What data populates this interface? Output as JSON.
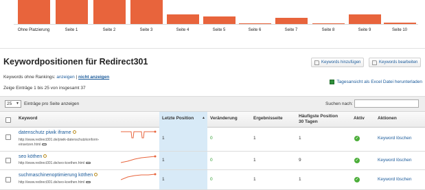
{
  "chart_data": {
    "type": "bar",
    "categories": [
      "Ohne Platzierung",
      "Seite 1",
      "Seite 2",
      "Seite 3",
      "Seite 4",
      "Seite 5",
      "Seite 6",
      "Seite 7",
      "Seite 8",
      "Seite 9",
      "Seite 10"
    ],
    "values": [
      34,
      34,
      34,
      34,
      14,
      11,
      2,
      9,
      2,
      14,
      3
    ],
    "ylim": [
      0,
      34
    ],
    "color": "#e8643c"
  },
  "page_title": "Keywordpositionen für Redirect301",
  "buttons": {
    "add": "Keywords hinzufügen",
    "edit": "Keywords bearbeiten",
    "export": "Tagesansicht als Excel Datei herunterladen"
  },
  "filter": {
    "prefix": "Keywords ohne Rankings:",
    "show": "anzeigen",
    "separator": "|",
    "hide": "nicht anzeigen"
  },
  "info": "Zeige Einträge 1 bis 25 von insgesamt 37",
  "page_size": "25",
  "per_page_label": "Einträge pro Seite anzeigen",
  "search_label": "Suchen nach:",
  "search_value": "",
  "columns": {
    "keyword": "Keyword",
    "position": "Letzte Position",
    "change": "Veränderung",
    "results": "Ergebnisseite",
    "best1": "Häufigste Position",
    "best2": "30 Tagen",
    "active": "Aktiv",
    "actions": "Aktionen"
  },
  "rows": [
    {
      "keyword": "datenschutz piwik iframe",
      "url1": "http://www.redirect301.de/piwik-datenschutzkonform-",
      "url2": "einsetzen.html",
      "position": "1",
      "change": "0",
      "results": "1",
      "best": "1",
      "action": "Keyword löschen"
    },
    {
      "keyword": "seo köthen",
      "url1": "http://www.redirect301.de/seo-koethen.html",
      "url2": "",
      "position": "1",
      "change": "0",
      "results": "1",
      "best": "9",
      "action": "Keyword löschen"
    },
    {
      "keyword": "suchmaschinenoptimierung köthen",
      "url1": "http://www.redirect301.de/seo-koethen.html",
      "url2": "",
      "position": "1",
      "change": "0",
      "results": "1",
      "best": "1",
      "action": "Keyword löschen"
    }
  ]
}
